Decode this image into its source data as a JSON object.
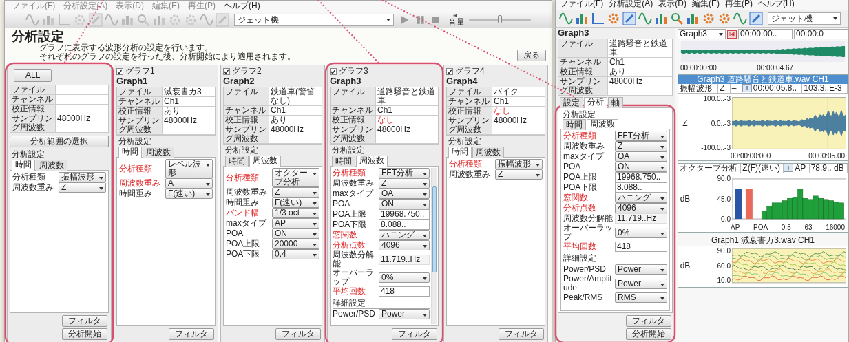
{
  "main_window": {
    "menu": [
      {
        "label": "ファイル(F)",
        "disabled": true
      },
      {
        "label": "分析設定(A)",
        "disabled": true
      },
      {
        "label": "表示(D)",
        "disabled": true
      },
      {
        "label": "編集(E)",
        "disabled": true
      },
      {
        "label": "再生(P)",
        "disabled": true
      },
      {
        "label": "ヘルプ(H)",
        "disabled": false
      }
    ],
    "toolbar": {
      "icons_disabled": true,
      "preset": "ジェット機",
      "volume_label": "音量",
      "volume": {
        "level": 0.5
      }
    },
    "heading": "分析設定",
    "description": [
      "グラフに表示する波形分析の設定を行います。",
      "それぞれのグラフの設定を行った後、分析開始により適用されます。"
    ],
    "back_button": "戻る",
    "panels": [
      {
        "kind": "all",
        "button": "ALL",
        "scrollable": false,
        "info": [
          {
            "label": "ファイル"
          },
          {
            "label": "チャンネル"
          },
          {
            "label": "校正情報"
          },
          {
            "label": "サンプリング周波数",
            "value": "48000Hz",
            "warning": false
          }
        ],
        "range_button": "分析範囲の選択",
        "section": "分析設定",
        "tabs": [
          {
            "label": "時間",
            "selected": true
          },
          {
            "label": "周波数",
            "selected": false
          }
        ],
        "fields": [
          {
            "label": "分析種類",
            "value": "振幅波形",
            "kind": "select",
            "required": false
          },
          {
            "label": "周波数重み",
            "value": "Z",
            "kind": "select",
            "required": false
          }
        ],
        "buttons": [
          "フィルタ",
          "分析開始"
        ]
      },
      {
        "kind": "graph",
        "checkbox": {
          "label": "グラフ1",
          "checked": true
        },
        "title": "Graph1",
        "scrollable": false,
        "info": [
          {
            "label": "ファイル",
            "value": "減衰書カ3",
            "warning": false
          },
          {
            "label": "チャンネル",
            "value": "Ch1",
            "warning": false
          },
          {
            "label": "校正情報",
            "value": "あり",
            "warning": false
          },
          {
            "label": "サンプリング周波数",
            "value": "48000Hz",
            "warning": false
          }
        ],
        "section": "分析設定",
        "tabs": [
          {
            "label": "時間",
            "selected": true
          },
          {
            "label": "周波数",
            "selected": false
          }
        ],
        "fields": [
          {
            "label": "分析種類",
            "value": "レベル波形",
            "kind": "select",
            "required": true
          },
          {
            "label": "周波数重み",
            "value": "A",
            "kind": "select",
            "required": true
          },
          {
            "label": "時間重み",
            "value": "F(速い)",
            "kind": "select",
            "required": false
          }
        ],
        "buttons": [
          "フィルタ"
        ]
      },
      {
        "kind": "graph",
        "checkbox": {
          "label": "グラフ2",
          "checked": true
        },
        "title": "Graph2",
        "scrollable": false,
        "info": [
          {
            "label": "ファイル",
            "value": "鉄道車(警笛なし)",
            "warning": false
          },
          {
            "label": "チャンネル",
            "value": "Ch1",
            "warning": false
          },
          {
            "label": "校正情報",
            "value": "あり",
            "warning": false
          },
          {
            "label": "サンプリング周波数",
            "value": "48000Hz",
            "warning": false
          }
        ],
        "section": "分析設定",
        "tabs": [
          {
            "label": "時間",
            "selected": false
          },
          {
            "label": "周波数",
            "selected": true
          }
        ],
        "fields": [
          {
            "label": "分析種類",
            "value": "オクターブ分析",
            "kind": "select",
            "required": true
          },
          {
            "label": "周波数重み",
            "value": "Z",
            "kind": "select",
            "required": false
          },
          {
            "label": "時間重み",
            "value": "F(速い)",
            "kind": "select",
            "required": false
          },
          {
            "label": "バンド幅",
            "value": "1/3 oct",
            "kind": "select",
            "required": true
          },
          {
            "label": "maxタイプ",
            "value": "AP",
            "kind": "select",
            "required": false
          },
          {
            "label": "POA",
            "value": "ON",
            "kind": "select",
            "required": false
          },
          {
            "label": "POA上限",
            "value": "20000",
            "kind": "select",
            "required": false
          },
          {
            "label": "POA下限",
            "value": "0.4",
            "kind": "select",
            "required": false
          }
        ],
        "buttons": [
          "フィルタ"
        ]
      },
      {
        "kind": "graph",
        "checkbox": {
          "label": "グラフ3",
          "checked": true
        },
        "title": "Graph3",
        "scrollable": true,
        "info": [
          {
            "label": "ファイル",
            "value": "道路騒音と鉄道車",
            "warning": false
          },
          {
            "label": "チャンネル",
            "value": "Ch1",
            "warning": false
          },
          {
            "label": "校正情報",
            "value": "なし",
            "warning": true
          },
          {
            "label": "サンプリング周波数",
            "value": "48000Hz",
            "warning": false
          }
        ],
        "section": "分析設定",
        "tabs": [
          {
            "label": "時間",
            "selected": false
          },
          {
            "label": "周波数",
            "selected": true
          }
        ],
        "fields": [
          {
            "label": "分析種類",
            "value": "FFT分析",
            "kind": "select",
            "required": true
          },
          {
            "label": "周波数重み",
            "value": "Z",
            "kind": "select",
            "required": false
          },
          {
            "label": "maxタイプ",
            "value": "OA",
            "kind": "select",
            "required": false
          },
          {
            "label": "POA",
            "value": "ON",
            "kind": "select",
            "required": false
          },
          {
            "label": "POA上限",
            "value": "19968.750..",
            "kind": "text",
            "required": false
          },
          {
            "label": "POA下限",
            "value": "8.088..",
            "kind": "text",
            "required": false
          },
          {
            "label": "窓関数",
            "value": "ハニング",
            "kind": "select",
            "required": true
          },
          {
            "label": "分析点数",
            "value": "4096",
            "kind": "select",
            "required": true
          },
          {
            "label": "周波数分解能",
            "value": "11.719..Hz",
            "kind": "readonly",
            "required": false
          },
          {
            "label": "オーバーラップ",
            "value": "0%",
            "kind": "select",
            "required": false
          },
          {
            "label": "平均回数",
            "value": "418",
            "kind": "text",
            "required": true
          }
        ],
        "details": {
          "label": "詳細設定",
          "fields": [
            {
              "label": "Power/PSD",
              "value": "Power",
              "kind": "select",
              "required": false
            }
          ]
        },
        "buttons": [
          "フィルタ"
        ]
      },
      {
        "kind": "graph",
        "checkbox": {
          "label": "グラフ4",
          "checked": true
        },
        "title": "Graph4",
        "scrollable": false,
        "info": [
          {
            "label": "ファイル",
            "value": "バイク",
            "warning": false
          },
          {
            "label": "チャンネル",
            "value": "Ch1",
            "warning": false
          },
          {
            "label": "校正情報",
            "value": "なし",
            "warning": true
          },
          {
            "label": "サンプリング周波数",
            "value": "48000Hz",
            "warning": false
          }
        ],
        "section": "分析設定",
        "tabs": [
          {
            "label": "時間",
            "selected": true
          },
          {
            "label": "周波数",
            "selected": false
          }
        ],
        "fields": [
          {
            "label": "分析種類",
            "value": "振幅波形",
            "kind": "select",
            "required": true
          },
          {
            "label": "周波数重み",
            "value": "Z",
            "kind": "select",
            "required": false
          }
        ],
        "buttons": [
          "フィルタ"
        ]
      }
    ]
  },
  "analysis_window": {
    "menu": [
      {
        "label": "ファイル(F)",
        "disabled": false
      },
      {
        "label": "分析設定(A)",
        "disabled": false
      },
      {
        "label": "表示(D)",
        "disabled": false
      },
      {
        "label": "編集(E)",
        "disabled": false
      },
      {
        "label": "再生(P)",
        "disabled": false
      },
      {
        "label": "ヘルプ(H)",
        "disabled": false
      }
    ],
    "toolbar": {
      "icons_disabled": false,
      "preset": "ジェット機"
    },
    "sidebar": {
      "title": "Graph3",
      "info": [
        {
          "label": "ファイル",
          "value": "道路騒音と鉄道車",
          "warning": false
        },
        {
          "label": "チャンネル",
          "value": "Ch1",
          "warning": false
        },
        {
          "label": "校正情報",
          "value": "あり",
          "warning": false
        },
        {
          "label": "サンプリング周波数",
          "value": "48000Hz",
          "warning": false
        }
      ],
      "tabs": [
        {
          "label": "設定",
          "selected": false
        },
        {
          "label": "分析",
          "selected": true
        },
        {
          "label": "軸",
          "selected": false
        }
      ],
      "section": "分析設定",
      "subtabs": [
        {
          "label": "時間",
          "selected": false
        },
        {
          "label": "周波数",
          "selected": true
        }
      ],
      "fields": [
        {
          "label": "分析種類",
          "value": "FFT分析",
          "kind": "select",
          "required": true
        },
        {
          "label": "周波数重み",
          "value": "Z",
          "kind": "select",
          "required": false
        },
        {
          "label": "maxタイプ",
          "value": "OA",
          "kind": "select",
          "required": false
        },
        {
          "label": "POA",
          "value": "ON",
          "kind": "select",
          "required": false
        },
        {
          "label": "POA上限",
          "value": "19968.750..",
          "kind": "text",
          "required": false
        },
        {
          "label": "POA下限",
          "value": "8.088..",
          "kind": "text",
          "required": false
        },
        {
          "label": "窓関数",
          "value": "ハニング",
          "kind": "select",
          "required": true
        },
        {
          "label": "分析点数",
          "value": "4096",
          "kind": "select",
          "required": true
        },
        {
          "label": "周波数分解能",
          "value": "11.719..Hz",
          "kind": "readonly",
          "required": false
        },
        {
          "label": "オーバーラップ",
          "value": "0%",
          "kind": "select",
          "required": false
        },
        {
          "label": "平均回数",
          "value": "418",
          "kind": "text",
          "required": true
        }
      ],
      "details": {
        "label": "詳細設定",
        "fields": [
          {
            "label": "Power/PSD",
            "value": "Power",
            "kind": "select",
            "required": false
          },
          {
            "label": "Power/Amplitude",
            "value": "Power",
            "kind": "select",
            "required": false
          },
          {
            "label": "Peak/RMS",
            "value": "RMS",
            "kind": "select",
            "required": false
          }
        ]
      },
      "buttons": [
        "フィルタ",
        "分析開始"
      ]
    },
    "overview": {
      "graph_select": "Graph3",
      "time_fields": [
        "00:00:00..",
        "00:00:0"
      ],
      "time_labels": [
        "00:00:00:00",
        "00:00:04.67"
      ]
    },
    "graphs": [
      {
        "kind": "waveform",
        "title": "Graph3 道路騒音と鉄道車.wav CH1",
        "header": [
          "振幅波形",
          "Z",
          "–",
          "00:00:05.8..",
          "103.3..E-3"
        ],
        "axis_label": "Z",
        "y_labels": [
          "100.0..-3",
          "0.0..-3",
          "-100.0..-3"
        ],
        "x_labels": [
          "00:00:00:000",
          "00:00:05.00"
        ]
      },
      {
        "kind": "octave",
        "header": [
          "オクターブ分析",
          "Z(F)(速い)",
          "AP",
          "78.9.. dB"
        ],
        "axis_label": "dB",
        "y_labels": [
          "90.0",
          "45.0",
          "0.0"
        ],
        "x_labels": [
          "AP",
          "POA",
          "0.5",
          "63",
          "16000"
        ]
      },
      {
        "kind": "lines",
        "title": "Graph1 減衰書カ3.wav CH1",
        "axis_label": "dB",
        "y_labels": [
          "90.0",
          "60.0",
          "10.0"
        ]
      }
    ]
  }
}
